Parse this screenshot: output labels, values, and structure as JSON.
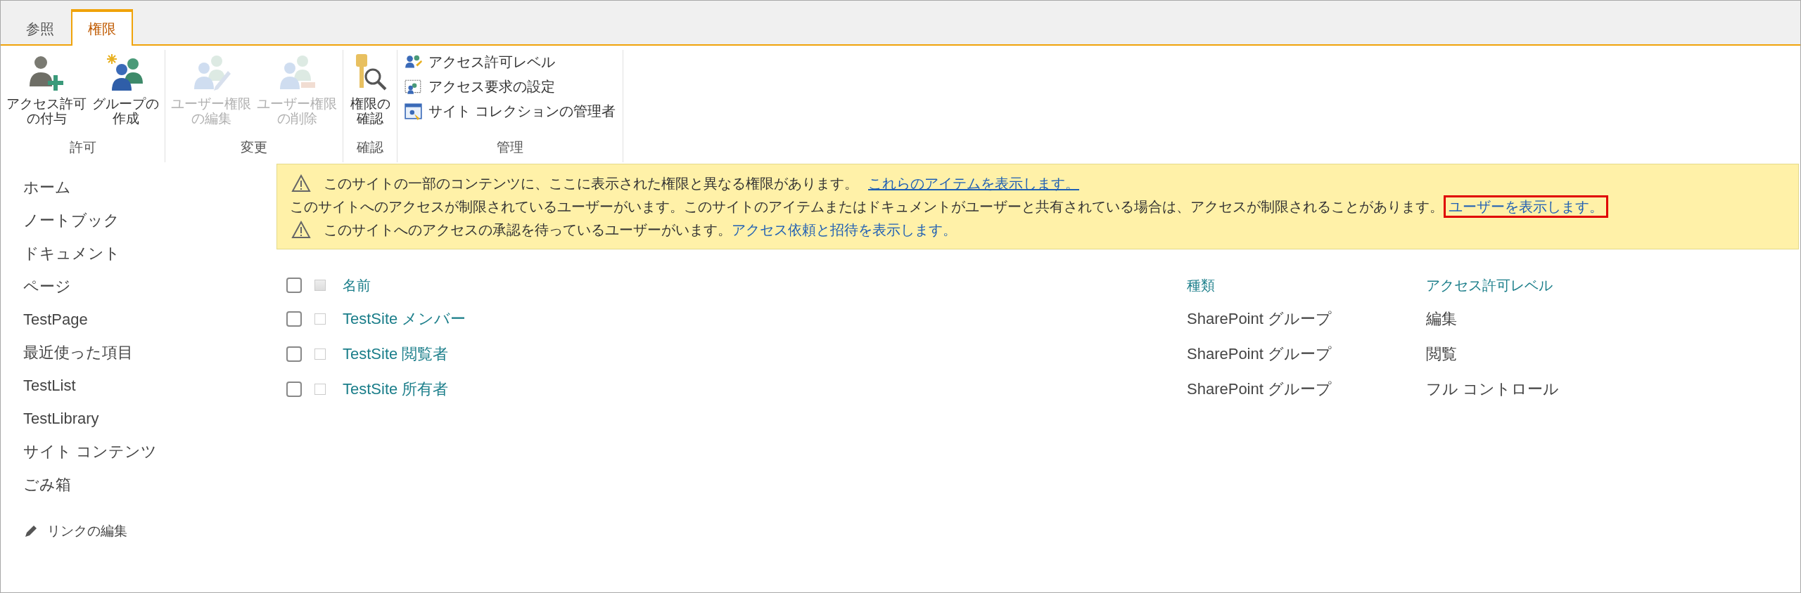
{
  "ribbon": {
    "tabs": [
      {
        "label": "参照",
        "selected": false
      },
      {
        "label": "権限",
        "selected": true
      }
    ],
    "groups": [
      {
        "label": "許可",
        "buttons": [
          {
            "kind": "large",
            "label": [
              "アクセス許可",
              "の付与"
            ],
            "disabled": false
          },
          {
            "kind": "large",
            "label": [
              "グループの",
              "作成"
            ],
            "disabled": false
          }
        ]
      },
      {
        "label": "変更",
        "buttons": [
          {
            "kind": "large",
            "label": [
              "ユーザー権限",
              "の編集"
            ],
            "disabled": true
          },
          {
            "kind": "large",
            "label": [
              "ユーザー権限",
              "の削除"
            ],
            "disabled": true
          }
        ]
      },
      {
        "label": "確認",
        "buttons": [
          {
            "kind": "large",
            "label": [
              "権限の",
              "確認"
            ],
            "disabled": false
          }
        ]
      },
      {
        "label": "管理",
        "buttons": [
          {
            "kind": "small",
            "label": [
              "アクセス許可レベル"
            ],
            "disabled": false
          },
          {
            "kind": "small",
            "label": [
              "アクセス要求の設定"
            ],
            "disabled": false
          },
          {
            "kind": "small",
            "label": [
              "サイト コレクションの管理者"
            ],
            "disabled": false
          }
        ]
      }
    ]
  },
  "nav": {
    "items": [
      "ホーム",
      "ノートブック",
      "ドキュメント",
      "ページ",
      "TestPage",
      "最近使った項目",
      "TestList",
      "TestLibrary",
      "サイト コンテンツ",
      "ごみ箱"
    ],
    "edit_links": "リンクの編集"
  },
  "banner": [
    {
      "warning": true,
      "text": "このサイトの一部のコンテンツに、ここに表示された権限と異なる権限があります。",
      "link": "これらのアイテムを表示します。",
      "underlined": true,
      "highlighted": false
    },
    {
      "warning": false,
      "text": "このサイトへのアクセスが制限されているユーザーがいます。このサイトのアイテムまたはドキュメントがユーザーと共有されている場合は、アクセスが制限されることがあります。",
      "link": "ユーザーを表示します。",
      "underlined": false,
      "highlighted": true
    },
    {
      "warning": true,
      "text": "このサイトへのアクセスの承認を待っているユーザーがいます。",
      "link": "アクセス依頼と招待を表示します。",
      "underlined": false,
      "highlighted": false
    }
  ],
  "table": {
    "select_all_checked": false,
    "columns": [
      "名前",
      "種類",
      "アクセス許可レベル"
    ],
    "rows": [
      {
        "name": "TestSite メンバー",
        "type": "SharePoint グループ",
        "level": "編集",
        "checked": false
      },
      {
        "name": "TestSite 閲覧者",
        "type": "SharePoint グループ",
        "level": "閲覧",
        "checked": false
      },
      {
        "name": "TestSite 所有者",
        "type": "SharePoint グループ",
        "level": "フル コントロール",
        "checked": false
      }
    ]
  }
}
